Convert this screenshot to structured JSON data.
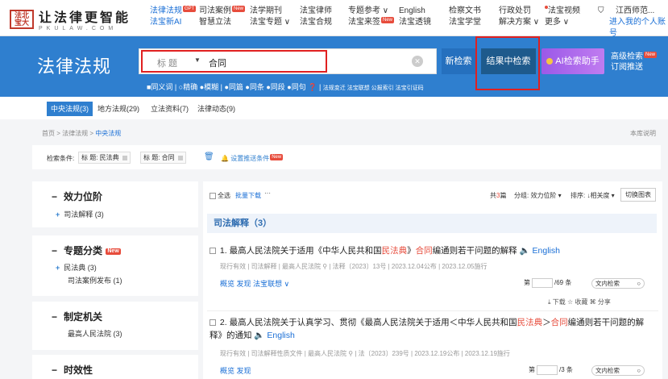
{
  "logo": {
    "seal": "法北宝大",
    "name_cn": "让法律更智能",
    "name_en": "PKULAW.COM"
  },
  "nav": [
    {
      "l1": "法律法规",
      "l1_badge": "GPT",
      "l2": "法宝新AI",
      "active": true
    },
    {
      "l1": "司法案例",
      "l1_badge": "New",
      "l2": "智慧立法"
    },
    {
      "l1": "法学期刊",
      "l2": "法宝专题"
    },
    {
      "l1": "法宝律师",
      "l2": "法宝合规"
    },
    {
      "l1": "专题参考",
      "l1_badge": "",
      "l2": "法宝来签",
      "l2_badge": "New"
    },
    {
      "l1": "English",
      "l2": "法宝透镜"
    },
    {
      "l1": "检察文书",
      "l2": "法宝学堂"
    },
    {
      "l1": "行政处罚",
      "l2": "解决方案"
    },
    {
      "l1": "法宝视频",
      "l2": "更多"
    }
  ],
  "user": {
    "org": "江西师范...",
    "link": "进入我的个人账号"
  },
  "hero": {
    "title": "法律法规",
    "field": "标 题",
    "query": "合同",
    "btn_new": "新检索",
    "btn_inresult": "结果中检索",
    "btn_ai": "AI检索助手",
    "adv1": "高级检索",
    "adv1_badge": "New",
    "adv2": "订阅推送",
    "opts": "■同义词  |  ○精确 ●模糊  |  ●同篇 ●同条 ●同段 ●同句 ❓  |",
    "opts_small": "法规变迁  法宝联想  公报索引  法宝引证码"
  },
  "tabs": [
    "中央法规(3)",
    "地方法规(29)",
    "立法资料(7)",
    "法律动态(9)"
  ],
  "crumb": {
    "home": "首页 > 法律法规 >",
    "current": "中央法规",
    "help": "本库说明"
  },
  "conditions": {
    "label": "检索条件:",
    "chip1": "标 题:  民法典",
    "chip2": "标 题:  合同",
    "push": "设置推送条件",
    "push_badge": "New"
  },
  "facets": [
    {
      "title": "效力位阶",
      "items": [
        "司法解释 (3)"
      ]
    },
    {
      "title": "专题分类",
      "badge": "New",
      "items": [
        "民法典 (3)",
        "司法案例发布 (1)"
      ]
    },
    {
      "title": "制定机关",
      "items": [
        "最高人民法院 (3)"
      ]
    },
    {
      "title": "时效性",
      "items": []
    }
  ],
  "toolbar": {
    "select_all": "全选",
    "batch": "批量下载",
    "more": "···",
    "total_pre": "共",
    "total": "3",
    "total_post": "篇",
    "group": "分组: 效力位阶 ▾",
    "sort": "排序: ↓相关度 ▾",
    "switch": "切换图表"
  },
  "section": "司法解释（3）",
  "docs": [
    {
      "t_pre": "1. 最高人民法院关于适用《中华人民共和国",
      "t_hl1": "民法典",
      "t_mid": "》",
      "t_hl2": "合同",
      "t_post": "编通则若干问题的解释",
      "english": "English",
      "meta": "现行有效  |  司法解释  |  最高人民法院 ⚲  |  法释〔2023〕13号  |  2023.12.04公布  |  2023.12.05施行",
      "actions": "概览    发现    法宝联想 ∨",
      "page_pre": "第",
      "page_post": "/69 条",
      "find": "文内检索",
      "tools": "⤓ 下载    ☆ 收藏    ⌘ 分享"
    },
    {
      "t_pre": "2. 最高人民法院关于认真学习、贯彻《最高人民法院关于适用＜中华人民共和国",
      "t_hl1": "民法典",
      "t_mid": "＞",
      "t_hl2": "合同",
      "t_post": "编通则若干问题的解释》的通知",
      "english": "English",
      "meta": "现行有效  |  司法解释性质文件  |  最高人民法院 ⚲  |  法〔2023〕239号  |  2023.12.19公布  |  2023.12.19施行",
      "actions": "概览    发现",
      "page_pre": "第",
      "page_post": "/3 条",
      "find": "文内检索"
    }
  ]
}
